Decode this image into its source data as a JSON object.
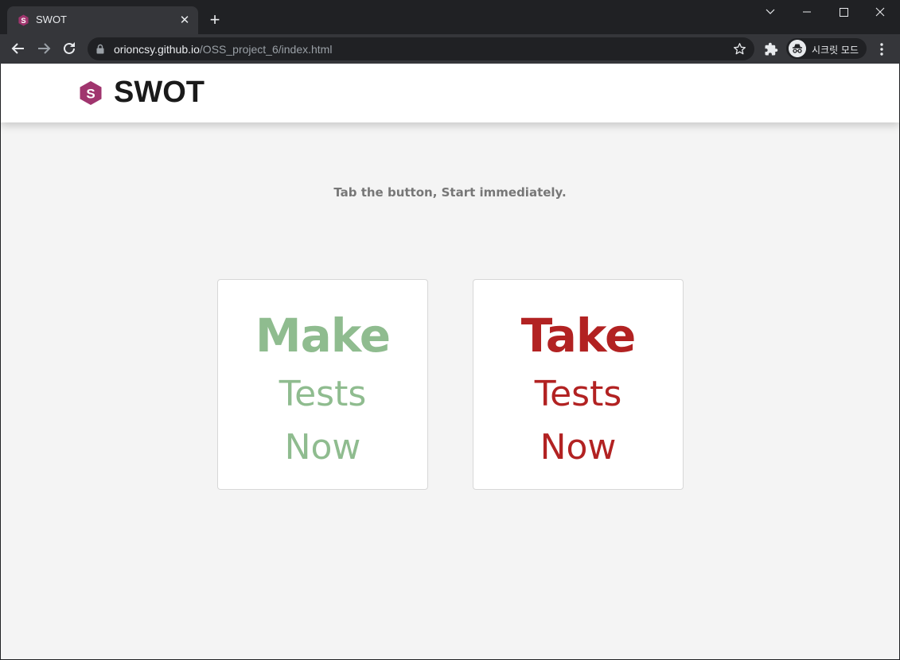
{
  "browser": {
    "tab_title": "SWOT",
    "url_host": "orioncsy.github.io",
    "url_path": "/OSS_project_6/index.html",
    "profile_label": "시크릿 모드",
    "icons": [
      "swot-favicon",
      "close-icon",
      "plus-icon",
      "chevron-down-icon",
      "minimize-icon",
      "maximize-icon",
      "close-window-icon",
      "back-arrow-icon",
      "forward-arrow-icon",
      "reload-icon",
      "lock-icon",
      "star-icon",
      "puzzle-icon",
      "incognito-icon",
      "kebab-menu-icon"
    ]
  },
  "header": {
    "logo_text": "SWOT"
  },
  "main": {
    "subtitle": "Tab the button, Start immediately.",
    "cards": [
      {
        "line1": "Make",
        "line2": "Tests",
        "line3": "Now",
        "color": "#8fbc8f"
      },
      {
        "line1": "Take",
        "line2": "Tests",
        "line3": "Now",
        "color": "#b22222"
      }
    ]
  },
  "colors": {
    "logo": "#a0356e",
    "make": "#8fbc8f",
    "take": "#b22222",
    "page_bg": "#f4f4f4"
  }
}
